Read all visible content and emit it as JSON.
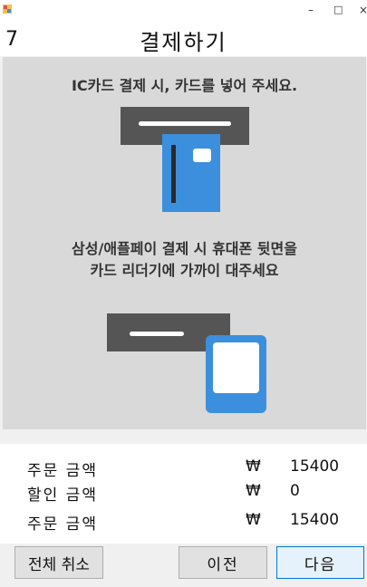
{
  "window": {
    "minimize_glyph": "–",
    "maximize_glyph": "□",
    "close_glyph": "×"
  },
  "header": {
    "counter": "7",
    "title": "결제하기"
  },
  "instructions": {
    "ic_card": "IC카드 결제 시, 카드를 넣어 주세요.",
    "mobile_line1": "삼성/애플페이 결제 시 휴대폰 뒷면을",
    "mobile_line2": "카드 리더기에 가까이 대주세요"
  },
  "summary": {
    "rows": [
      {
        "label": "주문 금액",
        "currency": "₩",
        "value": "15400"
      },
      {
        "label": "할인 금액",
        "currency": "₩",
        "value": "0"
      },
      {
        "label": "주문 금액",
        "currency": "₩",
        "value": "15400"
      }
    ]
  },
  "buttons": {
    "cancel_all": "전체 취소",
    "prev": "이전",
    "next": "다음"
  },
  "colors": {
    "reader": "#555555",
    "card": "#3b8fdc",
    "panel": "#d9d9d9",
    "accent_border": "#0078d7"
  },
  "icons": [
    "app-icon",
    "card-reader-icon",
    "phone-tap-icon"
  ]
}
